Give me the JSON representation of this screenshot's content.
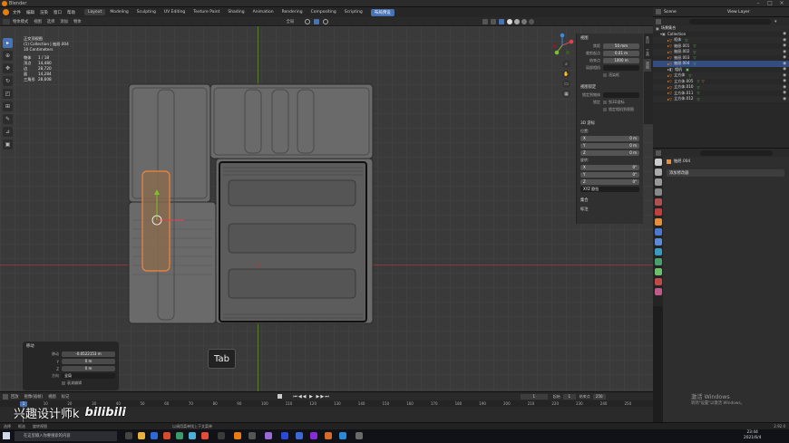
{
  "window": {
    "title": "Blender"
  },
  "menu": {
    "items": [
      "文件",
      "编辑",
      "渲染",
      "窗口",
      "帮助"
    ]
  },
  "workspaces": [
    "Layout",
    "Modeling",
    "Sculpting",
    "UV Editing",
    "Texture Paint",
    "Shading",
    "Animation",
    "Rendering",
    "Compositing",
    "Scripting"
  ],
  "workspaces_highlight": [
    "Layout"
  ],
  "workspace_extra": "布局预设",
  "scene": {
    "name": "Scene",
    "view_layer": "View Layer"
  },
  "viewport_header": {
    "mode": "物体模式",
    "view": "视图",
    "select": "选择",
    "add": "添加",
    "object": "物体",
    "orientation": "全局"
  },
  "stats": {
    "view_name": "正交顶视图",
    "collection_line": "(1) Collection | 抽屉.004",
    "scale_line": "10 Centimeters",
    "rows": [
      {
        "k": "物体",
        "v": "1 / 18"
      },
      {
        "k": "顶点",
        "v": "14,480"
      },
      {
        "k": "边",
        "v": "28,720"
      },
      {
        "k": "面",
        "v": "14,284"
      },
      {
        "k": "三角形",
        "v": "28,608"
      }
    ]
  },
  "npanel": {
    "view_header": "视图",
    "focal_label": "焦距",
    "focal_value": "50 mm",
    "clip_start_label": "裁剪起点",
    "clip_start_value": "0.01 m",
    "clip_end_label": "结束点",
    "clip_end_value": "1000 m",
    "local_camera_label": "局部相机",
    "render_region_label": "渲染框",
    "view_lock_header": "视图锁定",
    "lock_to_label": "锁定到物体",
    "lock_label": "锁定",
    "lock_to_3d_cursor": "到3D游标",
    "camera_to_view": "锁定相机到视图",
    "cursor_header": "3D 游标",
    "location_label": "位置:",
    "loc": [
      {
        "axis": "X",
        "value": "0 m"
      },
      {
        "axis": "Y",
        "value": "0 m"
      },
      {
        "axis": "Z",
        "value": "0 m"
      }
    ],
    "rotation_label": "旋转:",
    "rot": [
      {
        "axis": "X",
        "value": "0°"
      },
      {
        "axis": "Y",
        "value": "0°"
      },
      {
        "axis": "Z",
        "value": "0°"
      }
    ],
    "rot_mode": "XYZ 欧拉",
    "collections_header": "集合",
    "annotations_header": "标注",
    "tabs": [
      "条目",
      "工具",
      "视图"
    ]
  },
  "op_panel": {
    "title": "移动",
    "move_label": "移动",
    "x": "-0.0522153 m",
    "y": "0 m",
    "z": "0 m",
    "orientation_label": "方向",
    "orientation_value": "全局",
    "proportional": "衰减编辑"
  },
  "tab_key": "Tab",
  "outliner": {
    "root": "场景集合",
    "collection": "Collection",
    "items": [
      {
        "name": "柜体",
        "selected": false
      },
      {
        "name": "抽屉.001",
        "selected": false
      },
      {
        "name": "抽屉.002",
        "selected": false
      },
      {
        "name": "抽屉.003",
        "selected": false
      },
      {
        "name": "抽屉.004",
        "selected": true
      },
      {
        "name": "相机",
        "selected": false
      },
      {
        "name": "立方体",
        "selected": false
      },
      {
        "name": "立方体.005",
        "selected": false
      },
      {
        "name": "立方体.010",
        "selected": false
      },
      {
        "name": "立方体.011",
        "selected": false
      },
      {
        "name": "立方体.012",
        "selected": false
      }
    ]
  },
  "properties": {
    "object_name": "抽屉.004",
    "add_modifier": "添加修改器"
  },
  "timeline": {
    "menus": [
      "回放",
      "抠像(插帧)",
      "视图",
      "标记"
    ],
    "current_frame": "1",
    "start_label": "起始",
    "start": "1",
    "end_label": "结束点",
    "end": "250",
    "ticks": [
      "10",
      "20",
      "30",
      "40",
      "50",
      "60",
      "70",
      "80",
      "90",
      "100",
      "110",
      "120",
      "130",
      "140",
      "150",
      "160",
      "170",
      "180",
      "190",
      "200",
      "210",
      "220",
      "230",
      "240",
      "250"
    ]
  },
  "status": {
    "select": "选择",
    "box_select": "框选",
    "rotate": "旋转视图",
    "call_menu": "物体上下文菜单",
    "hint": "以调用菜单找上下文菜单",
    "version": "2.92.0"
  },
  "taskbar": {
    "search_placeholder": "在这里输入你要搜索的内容",
    "time": "23:44",
    "date": "2021/6/4"
  },
  "watermark": {
    "text": "兴趣设计师k",
    "logo": "bilibili"
  },
  "activation": {
    "title": "激活 Windows",
    "subtitle": "转到\"设置\"以激活 Windows。"
  }
}
